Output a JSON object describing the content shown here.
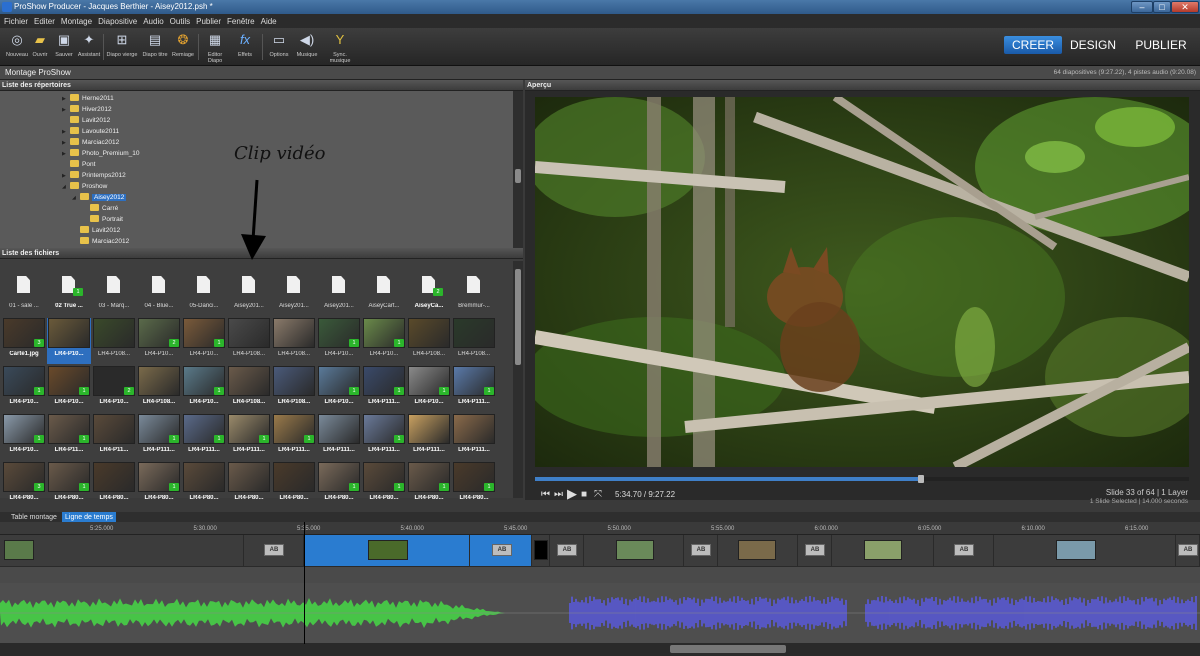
{
  "window": {
    "title": "ProShow Producer - Jacques Berthier - Aisey2012.psh *"
  },
  "menu": [
    "Fichier",
    "Editer",
    "Montage",
    "Diapositive",
    "Audio",
    "Outils",
    "Publier",
    "Fenêtre",
    "Aide"
  ],
  "toolbar": {
    "nouveau": "Nouveau",
    "ouvrir": "Ouvrir",
    "sauver": "Sauver",
    "assistant": "Assistant",
    "diapo_vierge": "Diapo vierge",
    "diapo_titre": "Diapo titre",
    "remiage": "Remiage",
    "editor_diapo": "Editor Diapo",
    "effets": "Effets",
    "options": "Options",
    "musique": "Musique",
    "sync_musique": "Sync. musique"
  },
  "modes": {
    "creer": "CREER",
    "design": "DESIGN",
    "publier": "PUBLIER"
  },
  "subheader": {
    "title": "Montage ProShow",
    "info": "64 diapositives (9:27.22), 4 pistes audio (9:20.08)"
  },
  "directory": {
    "title": "Liste des répertoires",
    "items": [
      "Herne2011",
      "Hiver2012",
      "Lavit2012",
      "Lavoute2011",
      "Marciac2012",
      "Photo_Premium_10",
      "Pont",
      "Printemps2012",
      "Proshow",
      "Aisey2012",
      "Carré",
      "Portrait",
      "Lavit2012",
      "Marciac2012"
    ]
  },
  "files": {
    "title": "Liste des fichiers",
    "row1": [
      "01 - sale ...",
      "02 True ...",
      "03 - Marq...",
      "04 - Blue...",
      "05-Danci...",
      "Aisey201...",
      "Aisey201...",
      "Aisey201...",
      "AiseyCart...",
      "AiseyCa...",
      "Bremmur-..."
    ],
    "row1_badges": [
      "",
      "1",
      "",
      "",
      "",
      "",
      "",
      "",
      "",
      "2",
      ""
    ],
    "row2": [
      "Carte1.jpg",
      "LR4-P10...",
      "LR4-P108...",
      "LR4-P10...",
      "LR4-P10...",
      "LR4-P108...",
      "LR4-P108...",
      "LR4-P10...",
      "LR4-P10...",
      "LR4-P108...",
      "LR4-P108..."
    ],
    "row2_badges": [
      "3",
      "",
      "",
      "2",
      "1",
      "",
      "",
      "1",
      "1",
      "",
      ""
    ],
    "row3": [
      "LR4-P10...",
      "LR4-P10...",
      "LR4-P10...",
      "LR4-P108...",
      "LR4-P10...",
      "LR4-P108...",
      "LR4-P108...",
      "LR4-P10...",
      "LR4-P111...",
      "LR4-P10...",
      "LR4-P111..."
    ],
    "row3_badges": [
      "1",
      "1",
      "2",
      "",
      "1",
      "",
      "",
      "1",
      "1",
      "1",
      "1"
    ],
    "row4": [
      "LR4-P10...",
      "LR4-P11...",
      "LR4-P11...",
      "LR4-P111...",
      "LR4-P111...",
      "LR4-P111...",
      "LR4-P111...",
      "LR4-P111...",
      "LR4-P111...",
      "LR4-P111...",
      "LR4-P111..."
    ],
    "row4_badges": [
      "1",
      "1",
      "",
      "1",
      "1",
      "1",
      "1",
      "",
      "1",
      "",
      ""
    ],
    "row5": [
      "LR4-P80...",
      "LR4-P80...",
      "LR4-P80...",
      "LR4-P80...",
      "LR4-P80...",
      "LR4-P80...",
      "LR4-P80...",
      "LR4-P80...",
      "LR4-P80...",
      "LR4-P80...",
      "LR4-P80..."
    ],
    "row5_badges": [
      "3",
      "1",
      "",
      "1",
      "",
      "",
      "",
      "1",
      "1",
      "1",
      "1"
    ],
    "annotation": "Clip vidéo"
  },
  "preview": {
    "title": "Aperçu",
    "progress": 0.59,
    "time": "5:34.70 / 9:27.22",
    "slide_info": "Slide 33 of 64  |  1 Layer",
    "selection_info": "1 Slide Selected  |  14.000 seconds"
  },
  "tabs": {
    "storyboard": "Table montage",
    "timeline": "Ligne de temps"
  },
  "ruler": [
    "5:25.000",
    "5:30.000",
    "5:35.000",
    "5:40.000",
    "5:45.000",
    "5:50.000",
    "5:55.000",
    "6:00.000",
    "6:05.000",
    "6:10.000",
    "6:15.000"
  ],
  "transition_label": "AB",
  "colors": {
    "accent": "#2a7cd0",
    "audio_green": "#47c447",
    "audio_blue": "#5a5ae0"
  }
}
